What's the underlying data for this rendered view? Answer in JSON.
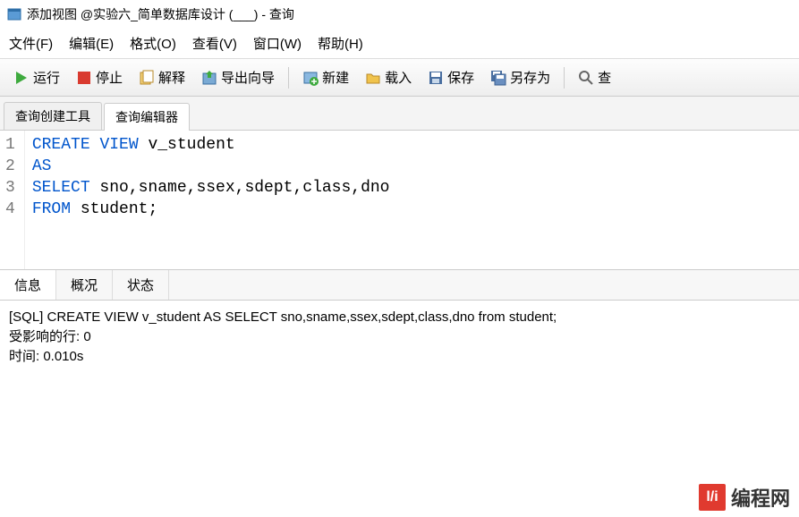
{
  "title": "添加视图 @实验六_简单数据库设计 (___) - 查询",
  "menu": {
    "file": "文件(F)",
    "edit": "编辑(E)",
    "format": "格式(O)",
    "view": "查看(V)",
    "window": "窗口(W)",
    "help": "帮助(H)"
  },
  "toolbar": {
    "run": "运行",
    "stop": "停止",
    "explain": "解释",
    "export": "导出向导",
    "new": "新建",
    "load": "载入",
    "save": "保存",
    "saveas": "另存为",
    "search": "查"
  },
  "tabs": {
    "builder": "查询创建工具",
    "editor": "查询编辑器"
  },
  "sql": {
    "line1_kw1": "CREATE",
    "line1_kw2": "VIEW",
    "line1_rest": " v_student",
    "line2": "AS",
    "line3_kw": "SELECT",
    "line3_rest": " sno,sname,ssex,sdept,class,dno",
    "line4_kw": "FROM",
    "line4_rest": " student;"
  },
  "bottom_tabs": {
    "info": "信息",
    "profile": "概况",
    "status": "状态"
  },
  "output": {
    "line1": "[SQL] CREATE VIEW v_student AS SELECT sno,sname,ssex,sdept,class,dno from student;",
    "line2": "受影响的行: 0",
    "line3": "时间: 0.010s"
  },
  "watermark": "编程网",
  "watermark_logo": "l/i"
}
